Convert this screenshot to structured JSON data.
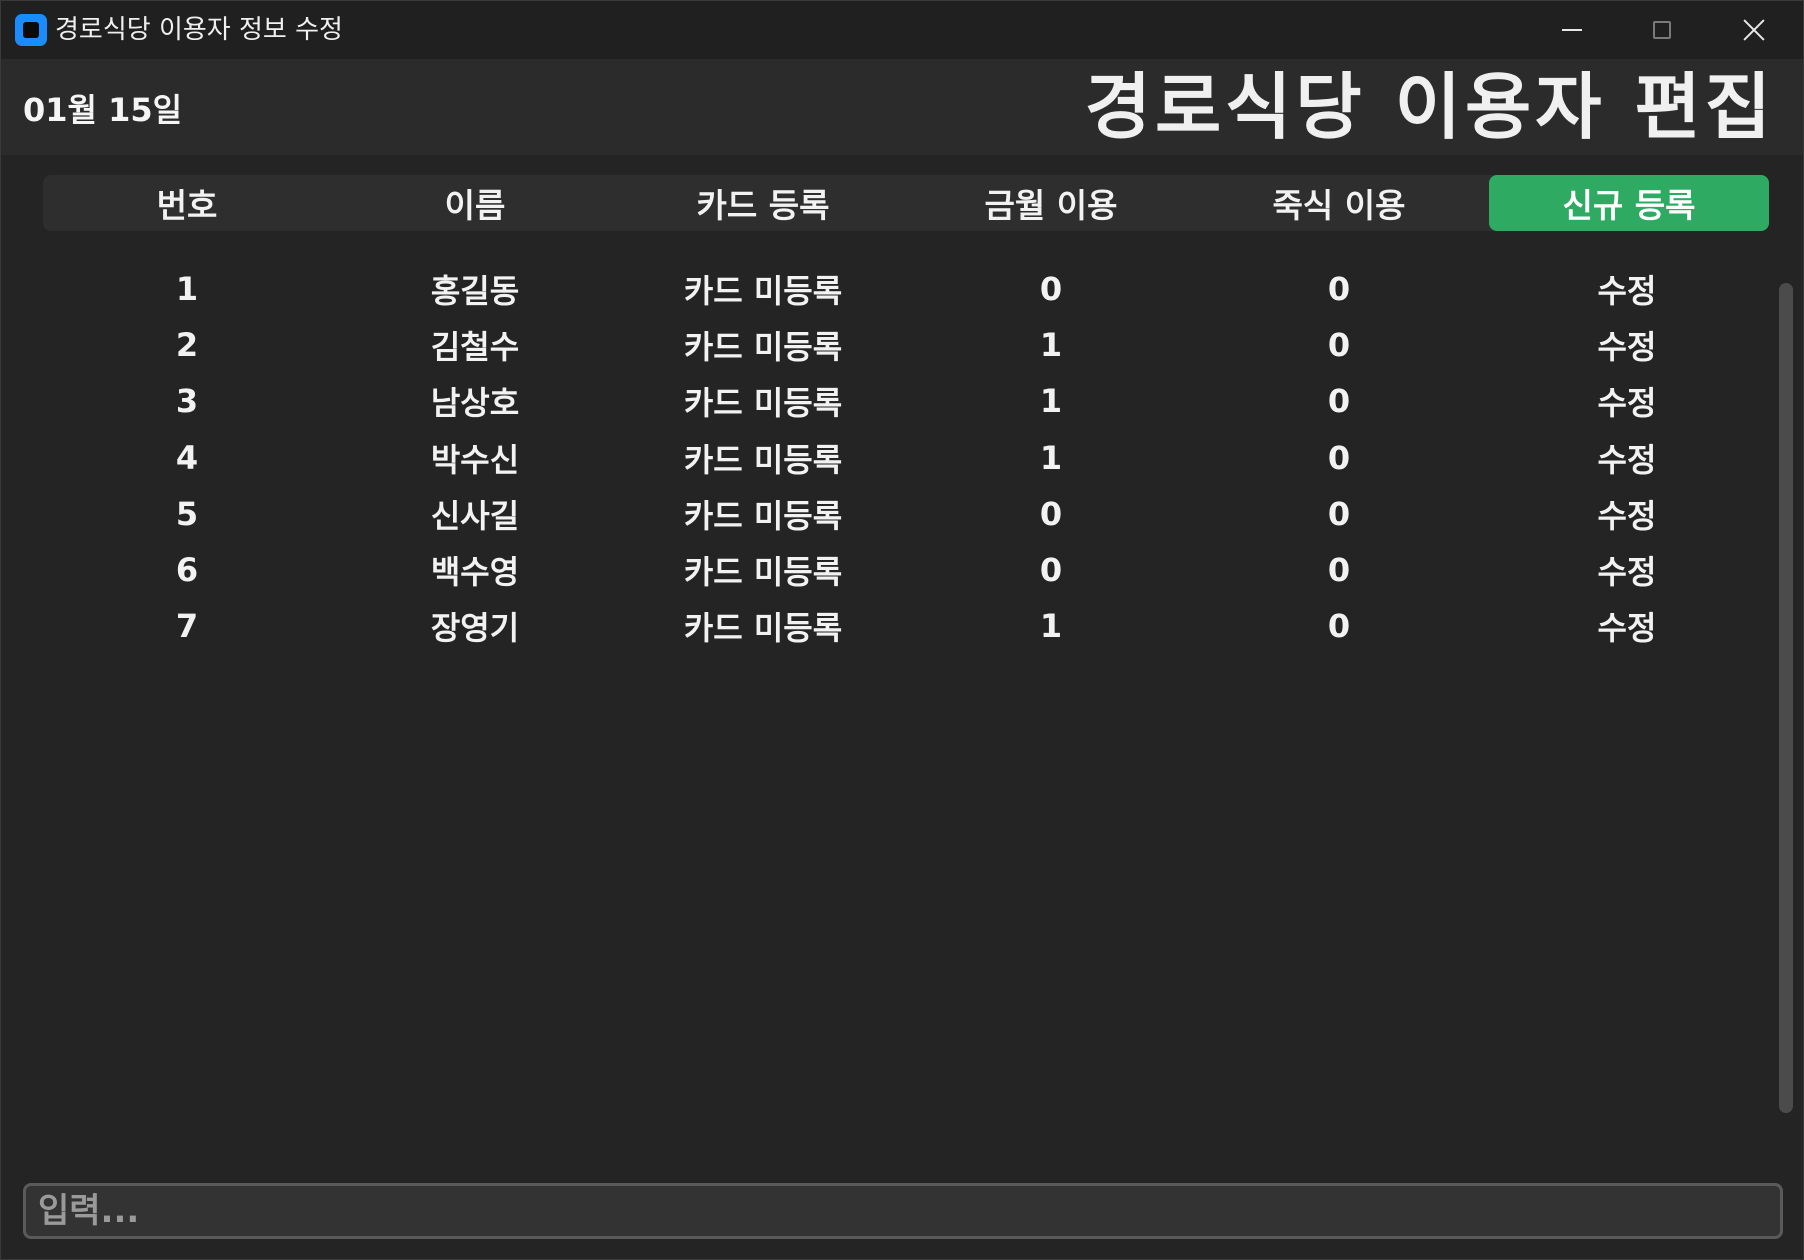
{
  "window": {
    "title": "경로식당 이용자 정보 수정"
  },
  "header": {
    "date": "01월 15일",
    "title": "경로식당 이용자 편집"
  },
  "columns": {
    "number": "번호",
    "name": "이름",
    "card": "카드 등록",
    "monthly": "금월 이용",
    "breakfast": "죽식 이용",
    "new_button": "신규 등록"
  },
  "rows": [
    {
      "number": "1",
      "name": "홍길동",
      "card": "카드 미등록",
      "monthly": "0",
      "breakfast": "0",
      "action": "수정"
    },
    {
      "number": "2",
      "name": "김철수",
      "card": "카드 미등록",
      "monthly": "1",
      "breakfast": "0",
      "action": "수정"
    },
    {
      "number": "3",
      "name": "남상호",
      "card": "카드 미등록",
      "monthly": "1",
      "breakfast": "0",
      "action": "수정"
    },
    {
      "number": "4",
      "name": "박수신",
      "card": "카드 미등록",
      "monthly": "1",
      "breakfast": "0",
      "action": "수정"
    },
    {
      "number": "5",
      "name": "신사길",
      "card": "카드 미등록",
      "monthly": "0",
      "breakfast": "0",
      "action": "수정"
    },
    {
      "number": "6",
      "name": "백수영",
      "card": "카드 미등록",
      "monthly": "0",
      "breakfast": "0",
      "action": "수정"
    },
    {
      "number": "7",
      "name": "장영기",
      "card": "카드 미등록",
      "monthly": "1",
      "breakfast": "0",
      "action": "수정"
    }
  ],
  "input": {
    "value": "",
    "placeholder": "입력..."
  },
  "colors": {
    "accent": "#2faa63",
    "background": "#242424"
  }
}
